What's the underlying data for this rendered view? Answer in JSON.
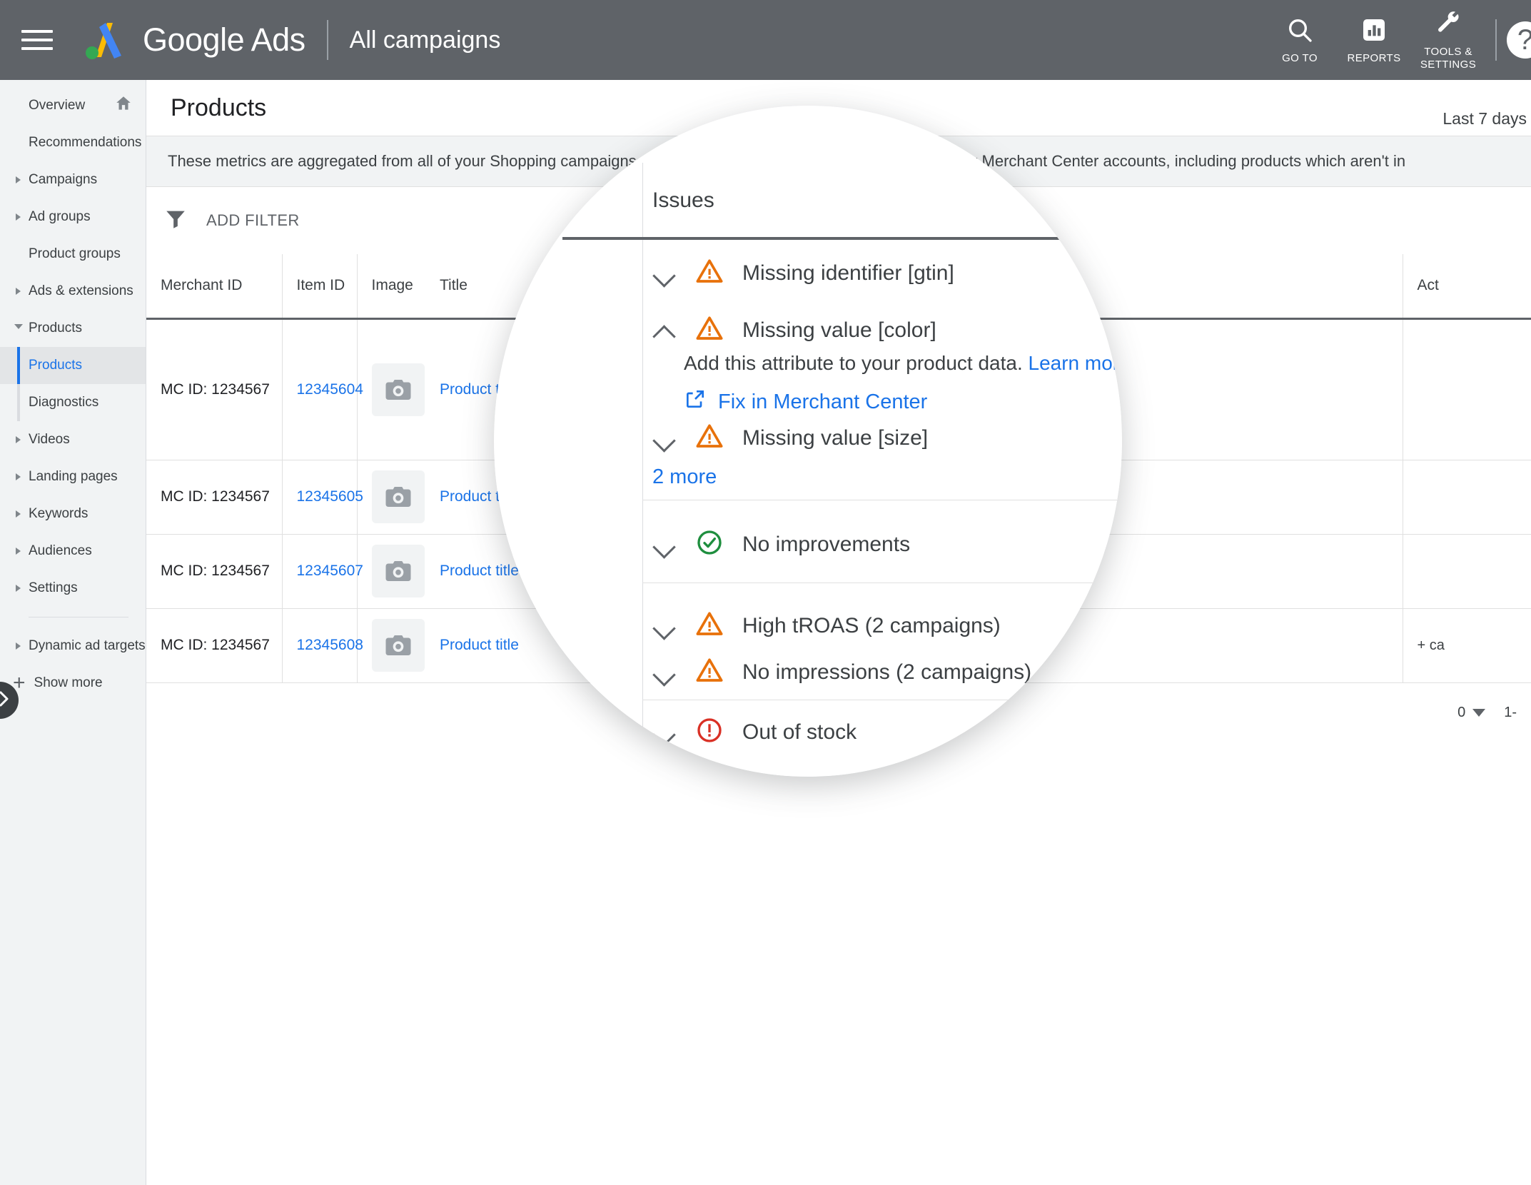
{
  "topbar": {
    "brand": "Google Ads",
    "scope": "All campaigns",
    "menu_icon": "hamburger-icon",
    "items": [
      {
        "label": "GO TO",
        "icon": "search-icon"
      },
      {
        "label": "REPORTS",
        "icon": "reports-bar-chart-icon"
      },
      {
        "label": "TOOLS &\nSETTINGS",
        "label_line1": "TOOLS &",
        "label_line2": "SETTINGS",
        "icon": "wrench-icon"
      }
    ],
    "help_label": "?"
  },
  "sidebar": {
    "items": [
      {
        "label": "Overview",
        "expandable": false,
        "trailing_icon": "home-icon"
      },
      {
        "label": "Recommendations",
        "expandable": false
      },
      {
        "label": "Campaigns",
        "expandable": true
      },
      {
        "label": "Ad groups",
        "expandable": true
      },
      {
        "label": "Product groups",
        "expandable": false
      },
      {
        "label": "Ads & extensions",
        "expandable": true
      },
      {
        "label": "Products",
        "expandable": true,
        "expanded": true
      },
      {
        "label": "Videos",
        "expandable": true
      },
      {
        "label": "Landing pages",
        "expandable": true
      },
      {
        "label": "Keywords",
        "expandable": true
      },
      {
        "label": "Audiences",
        "expandable": true
      },
      {
        "label": "Settings",
        "expandable": true
      },
      {
        "label": "Dynamic ad targets",
        "expandable": true
      }
    ],
    "sub_items": [
      {
        "label": "Products",
        "active": true
      },
      {
        "label": "Diagnostics",
        "active": false
      }
    ],
    "show_more": "Show more",
    "collapse_handle_icon": "chevron-right-icon"
  },
  "page": {
    "title": "Products",
    "date_range": "Last 7 days",
    "banner": "These metrics are aggregated from all of your Shopping campaigns. The table lists all the products submitted to your Merchant Center accounts, including products which aren't in",
    "banner_visible_left": "These metrics are aggregated from all of your Shopping campaigns. The table lists all the products submitt",
    "banner_visible_right": "nts, including products which aren't in",
    "add_filter": "ADD FILTER",
    "filter_icon": "filter-funnel-icon"
  },
  "table": {
    "columns": [
      "Merchant ID",
      "Item ID",
      "Image",
      "Title",
      "Issues",
      "Act"
    ],
    "rows": [
      {
        "merchant_id": "MC ID: 1234567",
        "item_id": "12345604",
        "image": "camera-placeholder-icon",
        "title": "Product title"
      },
      {
        "merchant_id": "MC ID: 1234567",
        "item_id": "12345605",
        "image": "camera-placeholder-icon",
        "title": "Product title"
      },
      {
        "merchant_id": "MC ID: 1234567",
        "item_id": "12345607",
        "image": "camera-placeholder-icon",
        "title": "Product title"
      },
      {
        "merchant_id": "MC ID: 1234567",
        "item_id": "12345608",
        "image": "camera-placeholder-icon",
        "title": "Product title"
      }
    ],
    "action_cell_text": "+ ca",
    "pager": {
      "rows_value": "0",
      "range": "1-"
    }
  },
  "lens": {
    "column_header": "Issues",
    "groups": [
      {
        "items": [
          {
            "label": "Missing identifier [gtin]",
            "icon": "warning-triangle-icon",
            "state": "collapsed"
          },
          {
            "label": "Missing value [color]",
            "icon": "warning-triangle-icon",
            "state": "expanded",
            "detail_text": "Add this attribute to your product data.",
            "detail_link": "Learn more",
            "action_link": "Fix in Merchant Center",
            "action_icon": "external-link-icon"
          },
          {
            "label": "Missing value [size]",
            "icon": "warning-triangle-icon",
            "state": "collapsed"
          }
        ],
        "more_link": "2 more"
      },
      {
        "items": [
          {
            "label": "No improvements",
            "icon": "check-circle-icon",
            "state": "collapsed"
          }
        ]
      },
      {
        "items": [
          {
            "label": "High tROAS (2 campaigns)",
            "icon": "warning-triangle-icon",
            "state": "collapsed"
          },
          {
            "label": "No impressions (2 campaigns)",
            "icon": "warning-triangle-icon",
            "state": "collapsed"
          }
        ]
      },
      {
        "items": [
          {
            "label": "Out of stock",
            "icon": "error-circle-icon",
            "state": "collapsed"
          }
        ]
      }
    ]
  },
  "colors": {
    "topbar": "#5f6368",
    "link": "#1a73e8",
    "warning": "#e8710a",
    "success": "#1e8e3e",
    "error": "#d93025",
    "sidebar_bg": "#f1f3f4"
  }
}
